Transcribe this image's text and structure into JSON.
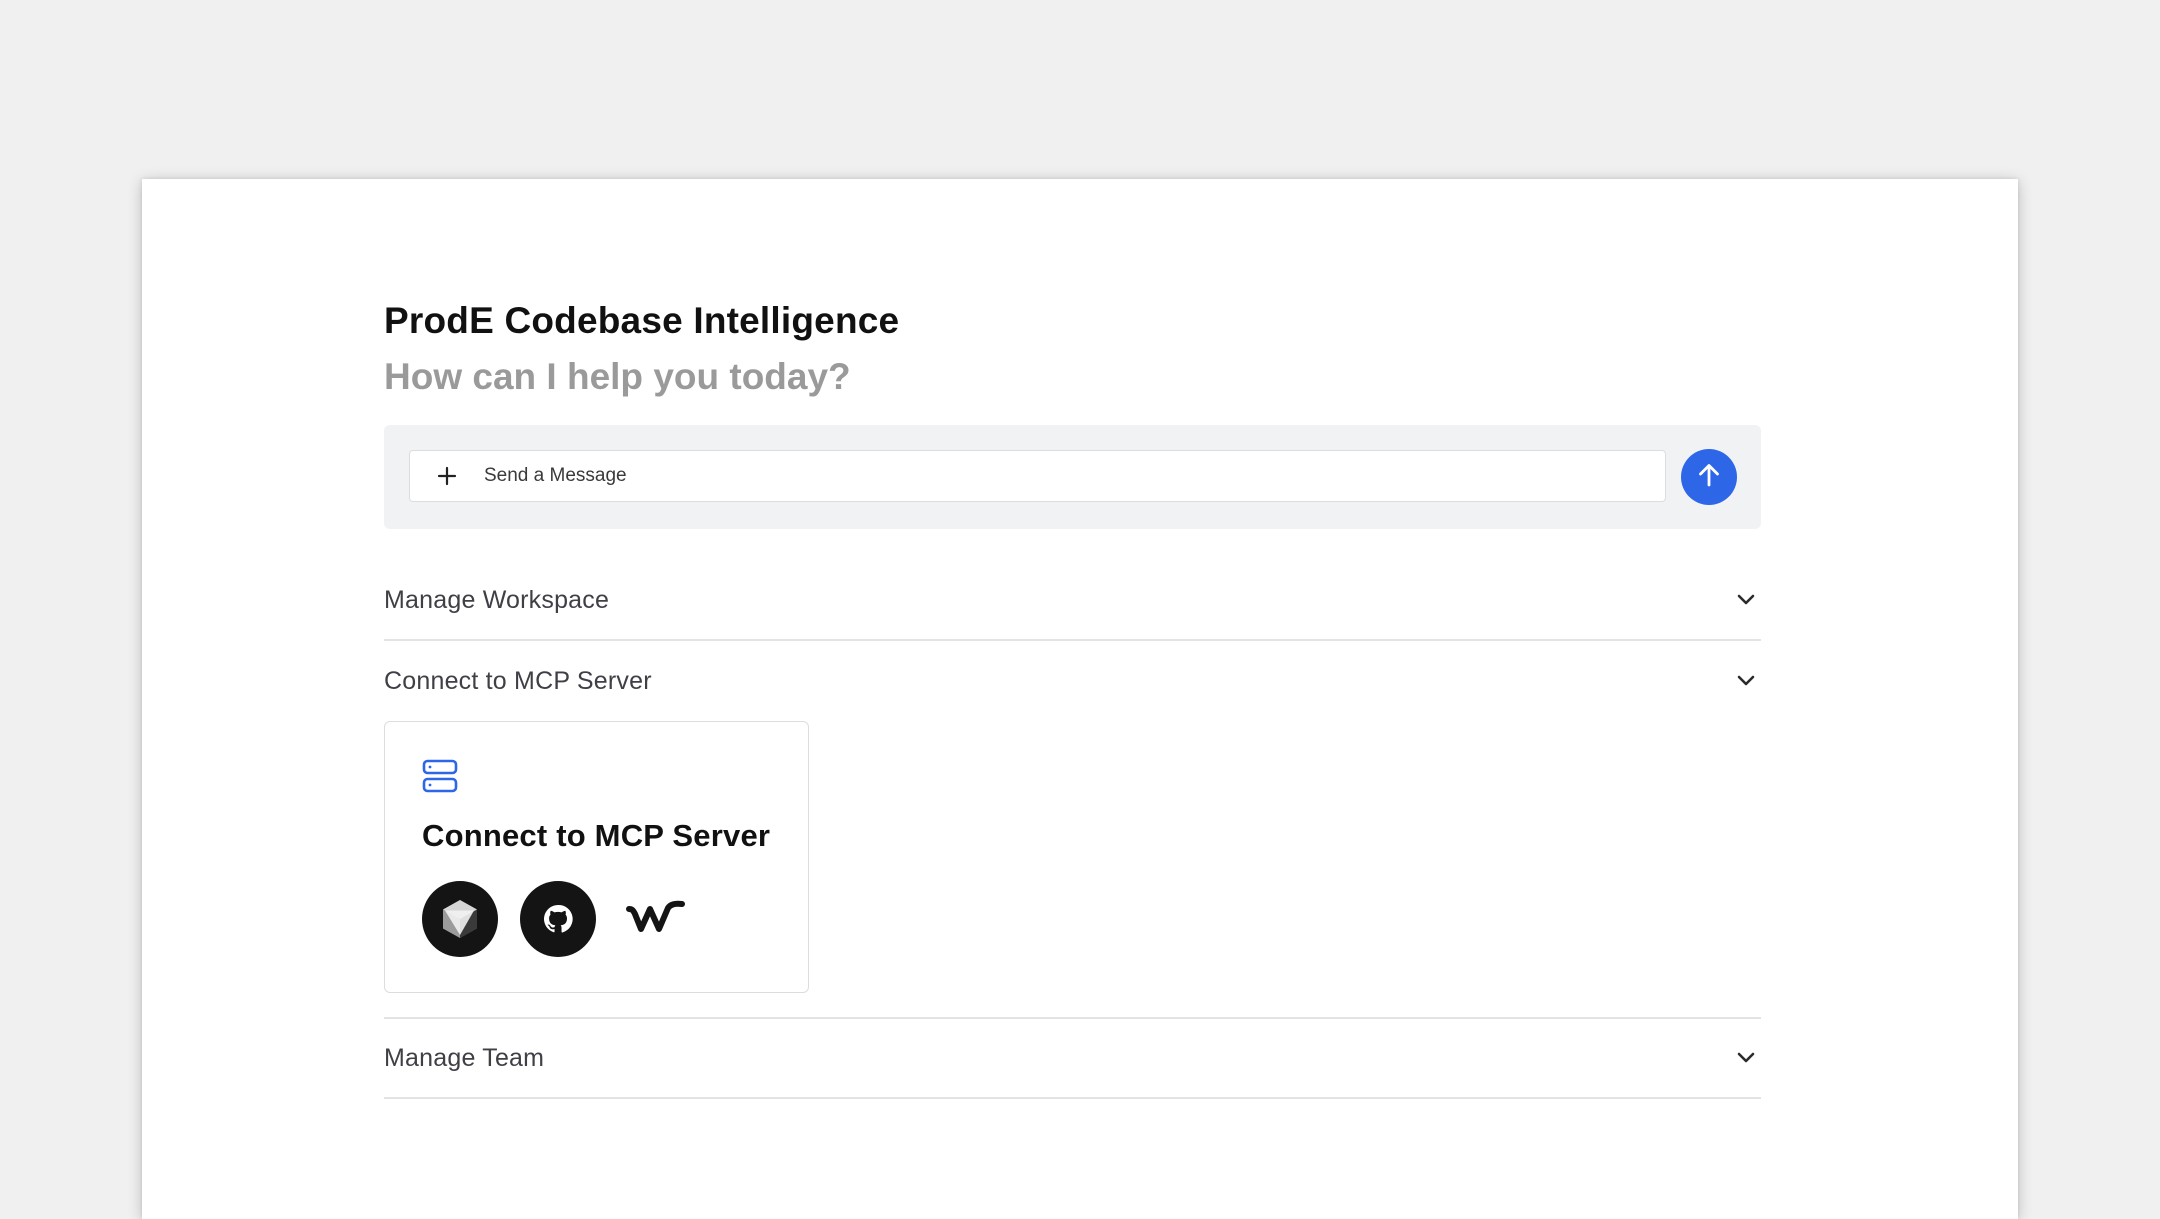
{
  "header": {
    "title": "ProdE Codebase Intelligence",
    "subtitle": "How can I help you today?"
  },
  "composer": {
    "placeholder": "Send a Message",
    "value": "",
    "add_icon": "plus-icon",
    "send_icon": "arrow-up-icon"
  },
  "sections": [
    {
      "label": "Manage Workspace",
      "expanded": false,
      "icon": "chevron-down-icon"
    },
    {
      "label": "Connect to MCP Server",
      "expanded": true,
      "icon": "chevron-down-icon"
    },
    {
      "label": "Manage Team",
      "expanded": false,
      "icon": "chevron-down-icon"
    }
  ],
  "mcp_card": {
    "icon": "server-icon",
    "title": "Connect to MCP Server",
    "logos": [
      "cursor-logo",
      "github-logo",
      "windsurf-logo"
    ]
  },
  "colors": {
    "accent": "#2d67e8",
    "background": "#f0f0f0",
    "title": "#111111",
    "subtitle": "#9a9a9a"
  }
}
